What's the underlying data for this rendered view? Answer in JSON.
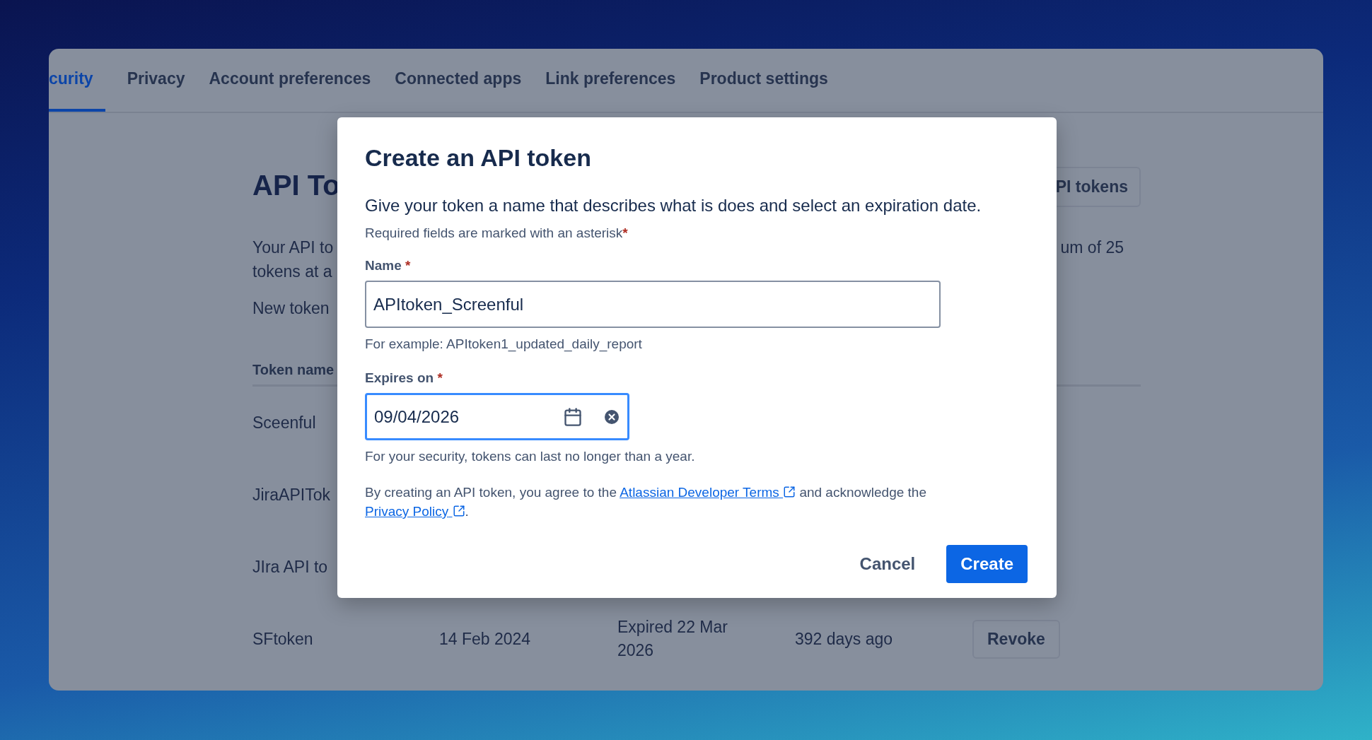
{
  "tabs": [
    {
      "label": "curity",
      "selected": true
    },
    {
      "label": "Privacy",
      "selected": false
    },
    {
      "label": "Account preferences",
      "selected": false
    },
    {
      "label": "Connected apps",
      "selected": false
    },
    {
      "label": "Link preferences",
      "selected": false
    },
    {
      "label": "Product settings",
      "selected": false
    }
  ],
  "page": {
    "title": "API To",
    "intro_lines": [
      "Your API to",
      "tokens at a"
    ],
    "intro_right": "um of 25",
    "note": "New token",
    "header_button": "PI tokens"
  },
  "table": {
    "columns": [
      "Token name"
    ],
    "rows": [
      {
        "cells": [
          "Sceenful"
        ]
      },
      {
        "cells": [
          "JiraAPITok"
        ]
      },
      {
        "cells": [
          "JIra API to"
        ]
      },
      {
        "cells": [
          "SFtoken",
          "14 Feb 2024",
          "Expired 22 Mar 2026",
          "392 days ago"
        ],
        "action": "Revoke"
      }
    ]
  },
  "dialog": {
    "title": "Create an API token",
    "description": "Give your token a name that describes what is does and select an expiration date.",
    "required_note": "Required fields are marked with an asterisk",
    "required_mark": "*",
    "fields": [
      {
        "kind": "text",
        "label": "Name",
        "required": true,
        "value": "APItoken_Screenful",
        "focused": false,
        "hint": "For example: APItoken1_updated_daily_report"
      },
      {
        "kind": "date",
        "label": "Expires on",
        "required": true,
        "value": "09/04/2026",
        "focused": true,
        "hint": "For your security, tokens can last no longer than a year."
      }
    ],
    "agreement": [
      {
        "kind": "text",
        "text": "By creating an API token, you agree to the "
      },
      {
        "kind": "link",
        "text": "Atlassian Developer Terms"
      },
      {
        "kind": "text",
        "text": " and acknowledge the "
      },
      {
        "kind": "link",
        "text": "Privacy Policy"
      },
      {
        "kind": "text",
        "text": "."
      }
    ],
    "buttons": [
      {
        "label": "Cancel",
        "kind": "subtle"
      },
      {
        "label": "Create",
        "kind": "primary"
      }
    ]
  }
}
